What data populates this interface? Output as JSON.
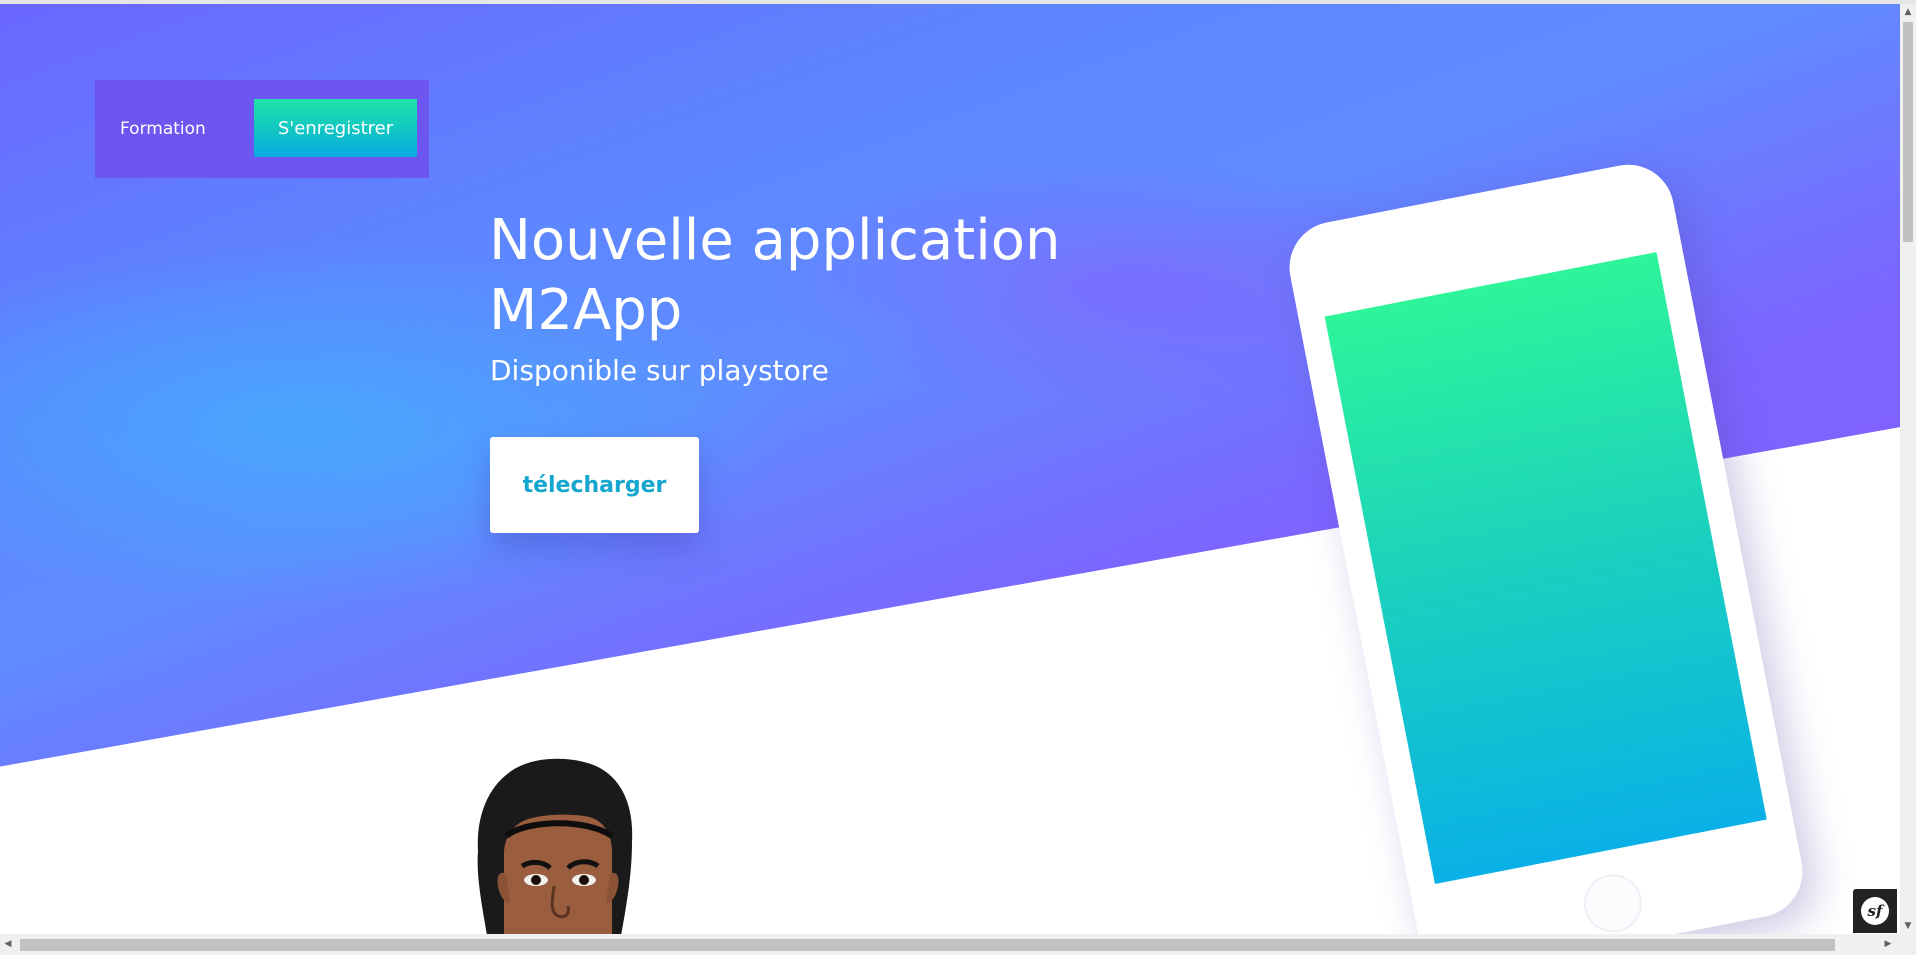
{
  "nav": {
    "formation_label": "Formation",
    "register_label": "S'enregistrer"
  },
  "hero": {
    "title": "Nouvelle application M2App",
    "subtitle": "Disponible sur playstore",
    "download_label": "télecharger"
  },
  "badge": {
    "symfony_label": "sf"
  },
  "colors": {
    "nav_bg": "#6d56ef",
    "register_button_gradient": [
      "#22e3a8",
      "#0aa9e3"
    ],
    "download_text": "#15a6cf",
    "phone_screen_gradient": [
      "#2ef49a",
      "#0ab0e6"
    ],
    "hero_gradient": [
      "#5d86ff",
      "#8f55ff"
    ]
  },
  "icons": {
    "phone": "phone-mockup-icon",
    "avatar": "avatar-illustration",
    "symfony": "symfony-icon"
  }
}
